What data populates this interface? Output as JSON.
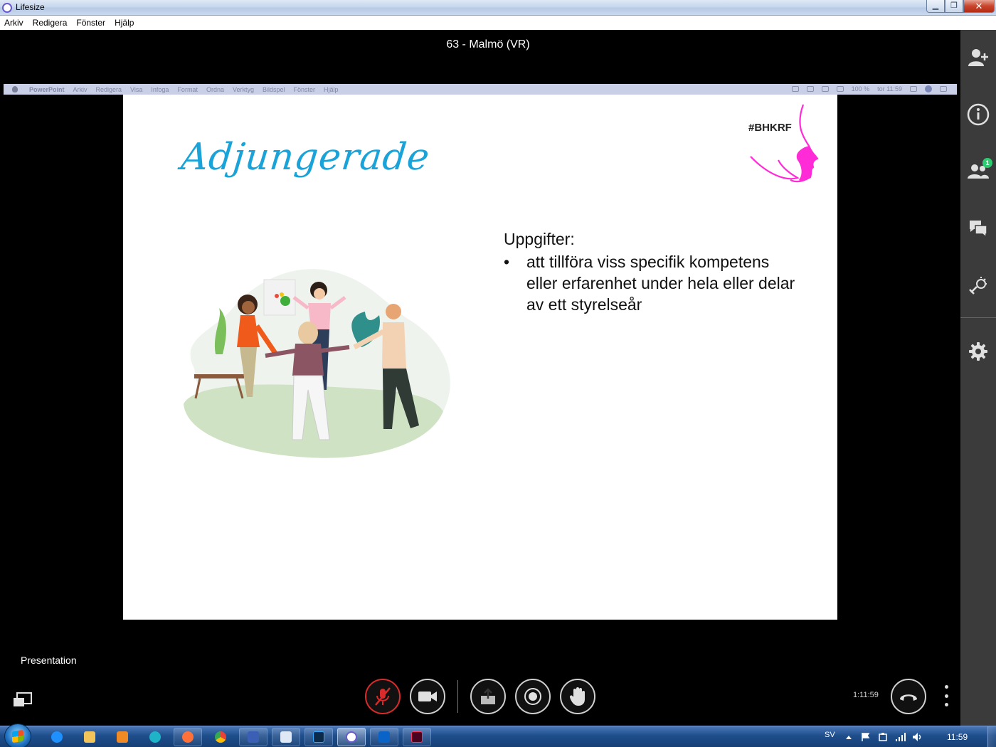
{
  "window": {
    "title": "Lifesize",
    "min": "▁",
    "max": "❐",
    "close": "✕"
  },
  "menubar": [
    "Arkiv",
    "Redigera",
    "Fönster",
    "Hjälp"
  ],
  "meeting": {
    "title": "63 - Malmö (VR)"
  },
  "shared_screen": {
    "mac_menu": [
      "PowerPoint",
      "Arkiv",
      "Redigera",
      "Visa",
      "Infoga",
      "Format",
      "Ordna",
      "Verktyg",
      "Bildspel",
      "Fönster",
      "Hjälp"
    ],
    "mac_status": {
      "battery": "100 %",
      "time": "tor 11:59"
    }
  },
  "slide": {
    "title": "Adjungerade",
    "tag": "#BHKRF",
    "heading": "Uppgifter:",
    "bullets": [
      "att tillföra viss specifik kompetens eller erfarenhet under hela eller delar av ett styrelseår"
    ],
    "colors": {
      "title": "#1aa3d9",
      "logo": "#ff2bd6"
    }
  },
  "sidebar": {
    "items": [
      "add-participant-icon",
      "info-icon",
      "participants-icon",
      "chat-icon",
      "meeting-tools-icon",
      "settings-icon"
    ],
    "participants_badge": "1"
  },
  "controls": {
    "presentation_label": "Presentation",
    "elapsed": "1:11:59",
    "buttons": [
      "mute-mic",
      "camera",
      "share-screen",
      "record",
      "raise-hand",
      "hang-up"
    ],
    "mic_muted": true
  },
  "taskbar": {
    "language": "SV",
    "clock": "11:59",
    "apps": [
      "internet-explorer",
      "file-explorer",
      "media-player",
      "edge",
      "firefox",
      "chrome",
      "save-app",
      "notes-app",
      "photoshop",
      "lifesize",
      "outlook",
      "indesign"
    ]
  }
}
